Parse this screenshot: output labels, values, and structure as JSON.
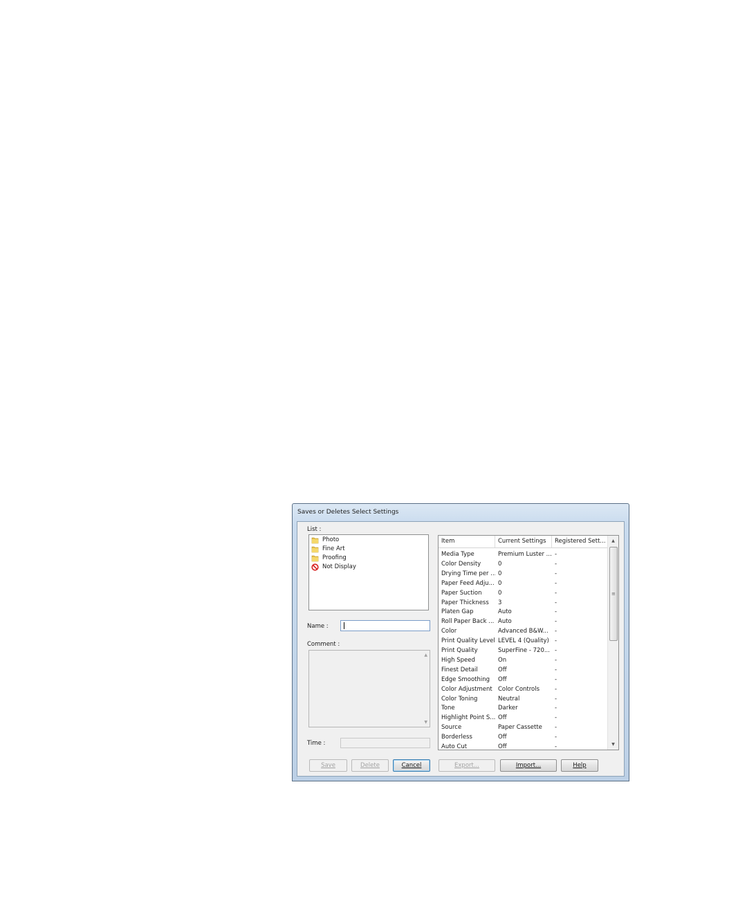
{
  "dialog": {
    "title": "Saves or Deletes Select Settings",
    "list_label": "List :",
    "list_items": [
      {
        "label": "Photo",
        "icon": "folder-icon"
      },
      {
        "label": "Fine Art",
        "icon": "folder-icon"
      },
      {
        "label": "Proofing",
        "icon": "folder-icon"
      },
      {
        "label": "Not Display",
        "icon": "not-display-icon"
      }
    ],
    "name_label": "Name :",
    "name_value": "",
    "comment_label": "Comment :",
    "time_label": "Time :",
    "columns": [
      "Item",
      "Current Settings",
      "Registered Sett..."
    ],
    "rows": [
      [
        "Media Type",
        "Premium Luster ...",
        "-"
      ],
      [
        "Color Density",
        "0",
        "-"
      ],
      [
        "Drying Time per ...",
        "0",
        "-"
      ],
      [
        "Paper Feed Adju...",
        "0",
        "-"
      ],
      [
        "Paper Suction",
        "0",
        "-"
      ],
      [
        "Paper Thickness",
        "3",
        "-"
      ],
      [
        "Platen Gap",
        "Auto",
        "-"
      ],
      [
        "Roll Paper Back ...",
        "Auto",
        "-"
      ],
      [
        "Color",
        "Advanced B&W...",
        "-"
      ],
      [
        "Print Quality Level",
        "LEVEL 4 (Quality)",
        "-"
      ],
      [
        "Print Quality",
        "SuperFine - 720...",
        "-"
      ],
      [
        "High Speed",
        "On",
        "-"
      ],
      [
        "Finest Detail",
        "Off",
        "-"
      ],
      [
        "Edge Smoothing",
        "Off",
        "-"
      ],
      [
        "Color Adjustment",
        "Color Controls",
        "-"
      ],
      [
        "Color Toning",
        "Neutral",
        "-"
      ],
      [
        "Tone",
        "Darker",
        "-"
      ],
      [
        "Highlight Point S...",
        "Off",
        "-"
      ],
      [
        "Source",
        "Paper Cassette",
        "-"
      ],
      [
        "Borderless",
        "Off",
        "-"
      ],
      [
        "Auto Cut",
        "Off",
        "-"
      ]
    ],
    "buttons": {
      "save": "Save",
      "delete": "Delete",
      "cancel": "Cancel",
      "export": "Export...",
      "import": "Import...",
      "help": "Help"
    }
  }
}
